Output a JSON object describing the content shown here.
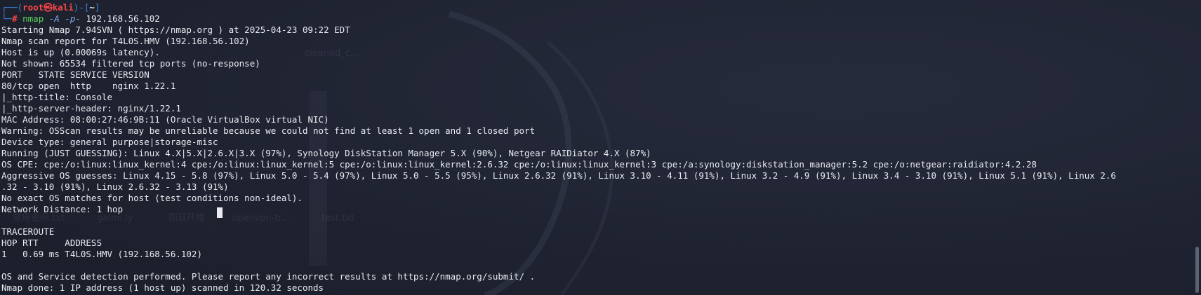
{
  "prompt": {
    "frame_open": "┌──(",
    "user_host": "root㉿kali",
    "sep": ")-[",
    "cwd": "~",
    "close": "]",
    "frame_close": "└─",
    "hash": "#"
  },
  "command": {
    "name": "nmap",
    "flags": "-A -p-",
    "target": "192.168.56.102"
  },
  "output": [
    "Starting Nmap 7.94SVN ( https://nmap.org ) at 2025-04-23 09:22 EDT",
    "Nmap scan report for T4L0S.HMV (192.168.56.102)",
    "Host is up (0.00069s latency).",
    "Not shown: 65534 filtered tcp ports (no-response)",
    "PORT   STATE SERVICE VERSION",
    "80/tcp open  http    nginx 1.22.1",
    "|_http-title: Console",
    "|_http-server-header: nginx/1.22.1",
    "MAC Address: 08:00:27:46:9B:11 (Oracle VirtualBox virtual NIC)",
    "Warning: OSScan results may be unreliable because we could not find at least 1 open and 1 closed port",
    "Device type: general purpose|storage-misc",
    "Running (JUST GUESSING): Linux 4.X|5.X|2.6.X|3.X (97%), Synology DiskStation Manager 5.X (90%), Netgear RAIDiator 4.X (87%)",
    "OS CPE: cpe:/o:linux:linux_kernel:4 cpe:/o:linux:linux_kernel:5 cpe:/o:linux:linux_kernel:2.6.32 cpe:/o:linux:linux_kernel:3 cpe:/a:synology:diskstation_manager:5.2 cpe:/o:netgear:raidiator:4.2.28",
    "Aggressive OS guesses: Linux 4.15 - 5.8 (97%), Linux 5.0 - 5.4 (97%), Linux 5.0 - 5.5 (95%), Linux 2.6.32 (91%), Linux 3.10 - 4.11 (91%), Linux 3.2 - 4.9 (91%), Linux 3.4 - 3.10 (91%), Linux 5.1 (91%), Linux 2.6",
    ".32 - 3.10 (91%), Linux 2.6.32 - 3.13 (91%)",
    "No exact OS matches for host (test conditions non-ideal).",
    "Network Distance: 1 hop",
    "",
    "TRACEROUTE",
    "HOP RTT     ADDRESS",
    "1   0.69 ms T4L0S.HMV (192.168.56.102)",
    "",
    "OS and Service detection performed. Please report any incorrect results at https://nmap.org/submit/ .",
    "Nmap done: 1 IP address (1 host up) scanned in 120.32 seconds"
  ],
  "background_labels": [
    "cleaned_c...",
    "常用密码.txt",
    "galmi.ly",
    "题目环境",
    "openvpn-tr...",
    "test.txt"
  ],
  "colors": {
    "background": "#1f2331",
    "text": "#e9ebf0",
    "prompt_frame": "#3c7fd6",
    "prompt_user": "#ff4646",
    "command": "#5ad35a",
    "flags": "#7fa9e6"
  }
}
